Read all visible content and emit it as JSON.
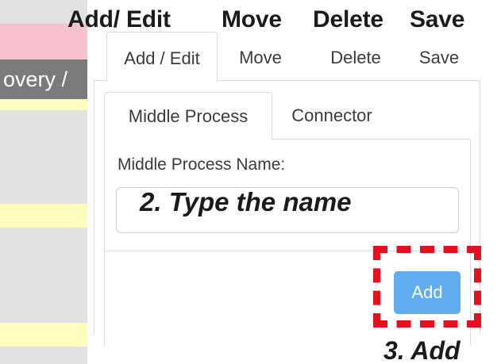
{
  "sidebar": {
    "visible_label": "overy /"
  },
  "annotations": {
    "top": [
      "Add/ Edit",
      "Move",
      "Delete",
      "Save"
    ],
    "type_name": "2. Type the name",
    "add_step": "3. Add"
  },
  "toolbar": {
    "tabs": [
      {
        "label": "Add / Edit",
        "active": true
      },
      {
        "label": "Move",
        "active": false
      },
      {
        "label": "Delete",
        "active": false
      },
      {
        "label": "Save",
        "active": false
      }
    ]
  },
  "subtabs": [
    {
      "label": "Middle Process",
      "active": true
    },
    {
      "label": "Connector",
      "active": false
    }
  ],
  "form": {
    "name_label": "Middle Process Name:",
    "name_value": "",
    "add_label": "Add"
  },
  "colors": {
    "add_button": "#62adef",
    "highlight_box": "#e3101d",
    "sidebar_pink": "#f7c2cd",
    "sidebar_gray": "#7b7b7b",
    "sidebar_yellow": "#fffcbd"
  }
}
